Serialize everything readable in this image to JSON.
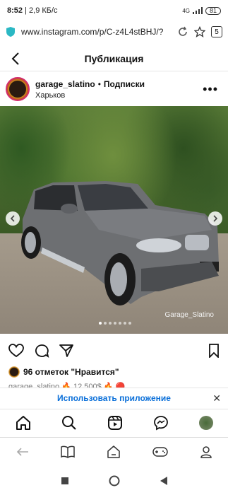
{
  "status_bar": {
    "time": "8:52",
    "speed": "2,9 КБ/с",
    "network": "4G",
    "battery": "81"
  },
  "browser": {
    "url": "www.instagram.com/p/C-z4L4stBHJ/?",
    "tab_count": "5"
  },
  "ig_header": {
    "title": "Публикация"
  },
  "post": {
    "username": "garage_slatino",
    "separator": "•",
    "follow_label": "Подписки",
    "location": "Харьков",
    "photo_watermark": "Garage_Slatino",
    "likes_text": "96 отметок \"Нравится\"",
    "caption_preview": "garage_slatino 🔥 12 500$ 🔥 🔴"
  },
  "app_banner": {
    "label": "Использовать приложение"
  },
  "colors": {
    "link_blue": "#0a6fd9",
    "story_ring": "#d32c6c"
  }
}
